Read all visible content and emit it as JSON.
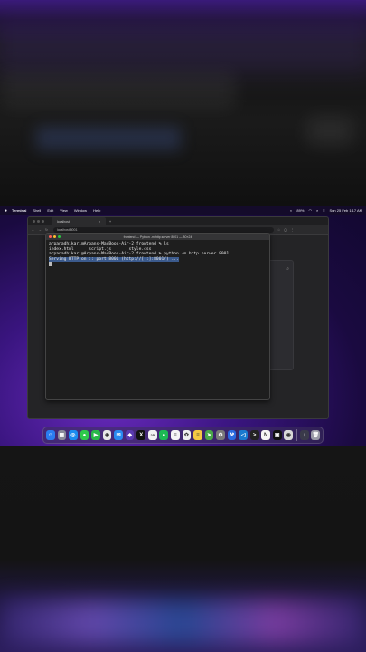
{
  "menubar": {
    "apple_icon": "apple-logo-icon",
    "items": [
      "Terminal",
      "Shell",
      "Edit",
      "View",
      "Window",
      "Help"
    ],
    "battery": "89%",
    "datetime": "Sun 25 Feb 1:17 AM"
  },
  "browser": {
    "tab_title": "localhost",
    "tab_close": "×",
    "new_tab": "+",
    "url": "localhost:8001"
  },
  "terminal": {
    "title": "frontend — Python -m http.server 8001 — 80×24",
    "lines": [
      "arpanadhikari@Arpans-MacBook-Air-2 frontend % ls",
      "index.html      script.js       style.css",
      "arpanadhikari@Arpans-MacBook-Air-2 frontend % python -m http.server 8001"
    ],
    "serving_line": "Serving HTTP on :: port 8001 (http://[::]:8001/) ..."
  },
  "dock": {
    "apps": [
      {
        "name": "finder-icon",
        "color": "#2a7cf0",
        "glyph": "☺"
      },
      {
        "name": "launchpad-icon",
        "color": "#8a8a9a",
        "glyph": "▦"
      },
      {
        "name": "safari-icon",
        "color": "#1a8cf0",
        "glyph": "◎"
      },
      {
        "name": "messages-icon",
        "color": "#2ec84a",
        "glyph": "●"
      },
      {
        "name": "facetime-icon",
        "color": "#2ab84a",
        "glyph": "▶"
      },
      {
        "name": "chrome-icon",
        "color": "#e8e8e8",
        "glyph": "◉"
      },
      {
        "name": "mail-icon",
        "color": "#2a8af0",
        "glyph": "✉"
      },
      {
        "name": "proton-icon",
        "color": "#5a3ab0",
        "glyph": "◆"
      },
      {
        "name": "x-icon",
        "color": "#111111",
        "glyph": "X"
      },
      {
        "name": "calendar-icon",
        "color": "#f2f2f2",
        "glyph": "25"
      },
      {
        "name": "spotify-icon",
        "color": "#1db954",
        "glyph": "●"
      },
      {
        "name": "reminders-icon",
        "color": "#f5f5f5",
        "glyph": "≡"
      },
      {
        "name": "photos-icon",
        "color": "#f0f0f0",
        "glyph": "✿"
      },
      {
        "name": "notes-icon",
        "color": "#f5c842",
        "glyph": "≡"
      },
      {
        "name": "maps-icon",
        "color": "#4aa84a",
        "glyph": "➤"
      },
      {
        "name": "settings-icon",
        "color": "#7a7a7a",
        "glyph": "⚙"
      },
      {
        "name": "xcode-icon",
        "color": "#2a6ae0",
        "glyph": "⚒"
      },
      {
        "name": "vscode-icon",
        "color": "#1a7ad0",
        "glyph": "◁"
      },
      {
        "name": "terminal-icon",
        "color": "#222222",
        "glyph": ">"
      },
      {
        "name": "notion-icon",
        "color": "#f5f5f5",
        "glyph": "N"
      },
      {
        "name": "pycharm-icon",
        "color": "#111111",
        "glyph": "▣"
      },
      {
        "name": "chrome2-icon",
        "color": "#d8d8d8",
        "glyph": "◉"
      }
    ],
    "trailing": [
      {
        "name": "downloads-icon",
        "color": "#3a3a4a",
        "glyph": "↓"
      },
      {
        "name": "trash-icon",
        "color": "#9a9aa8",
        "glyph": "🗑"
      }
    ]
  }
}
